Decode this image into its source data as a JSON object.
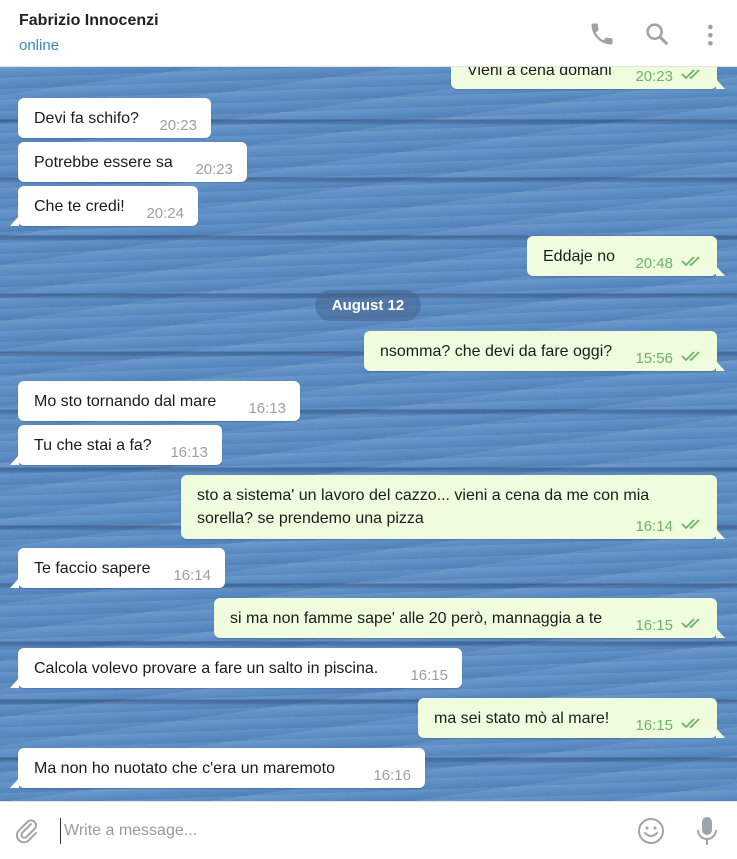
{
  "header": {
    "contact_name": "Fabrizio Innocenzi",
    "status": "online",
    "icons": [
      "phone-icon",
      "search-icon",
      "more-vertical-icon"
    ]
  },
  "date_separator": "August 12",
  "messages": [
    {
      "dir": "out",
      "text": "Vieni a cena domani",
      "time": "20:23",
      "read": true
    },
    {
      "dir": "in",
      "text": "Devi fa schifo?",
      "time": "20:23"
    },
    {
      "dir": "in",
      "text": "Potrebbe essere sa",
      "time": "20:23"
    },
    {
      "dir": "in",
      "text": "Che te credi!",
      "time": "20:24"
    },
    {
      "dir": "out",
      "text": "Eddaje no",
      "time": "20:48",
      "read": true
    },
    {
      "dir": "out",
      "text": "nsomma? che devi da fare oggi?",
      "time": "15:56",
      "read": true
    },
    {
      "dir": "in",
      "text": "Mo sto tornando dal mare",
      "time": "16:13"
    },
    {
      "dir": "in",
      "text": "Tu che stai a fa?",
      "time": "16:13"
    },
    {
      "dir": "out",
      "text_line1": "sto a sistema' un lavoro del cazzo... vieni a cena da me con mia",
      "text_line2": "sorella? se prendemo una pizza",
      "time": "16:14",
      "read": true
    },
    {
      "dir": "in",
      "text": "Te faccio sapere",
      "time": "16:14"
    },
    {
      "dir": "out",
      "text": "si ma non famme sape' alle 20 però, mannaggia a te",
      "time": "16:15",
      "read": true
    },
    {
      "dir": "in",
      "text": "Calcola volevo provare a fare un salto in piscina.",
      "time": "16:15"
    },
    {
      "dir": "out",
      "text": "ma sei stato mò al mare!",
      "time": "16:15",
      "read": true
    },
    {
      "dir": "in",
      "text": "Ma non ho nuotato che c'era un maremoto",
      "time": "16:16"
    }
  ],
  "composer": {
    "placeholder": "Write a message...",
    "icons": [
      "attach-icon",
      "emoji-icon",
      "microphone-icon"
    ]
  },
  "colors": {
    "outgoing_bubble": "#effdde",
    "incoming_bubble": "#ffffff",
    "read_check": "#6cb466",
    "status_online": "#3a8ac4"
  }
}
